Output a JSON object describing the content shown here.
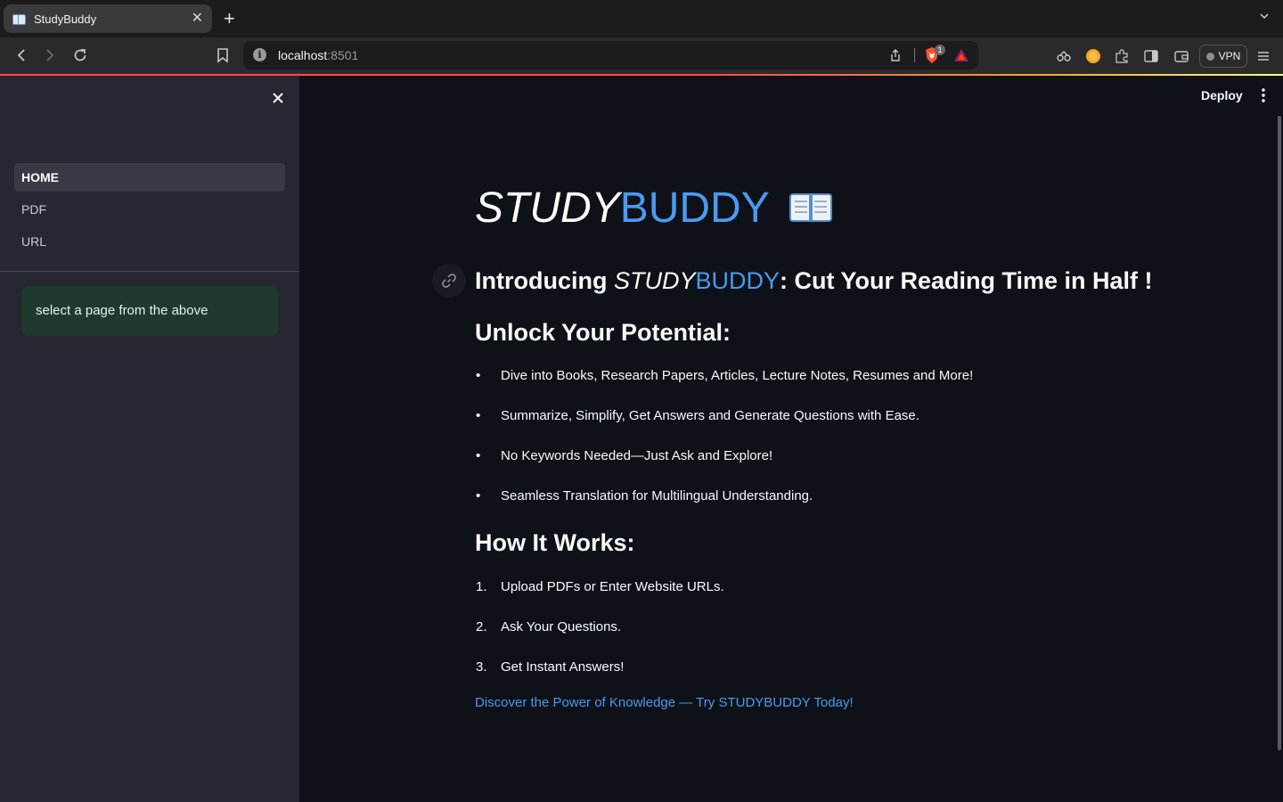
{
  "browser": {
    "tab_title": "StudyBuddy",
    "url_host": "localhost",
    "url_port": ":8501",
    "shields_count": "1",
    "vpn_label": "VPN"
  },
  "app": {
    "deploy_label": "Deploy",
    "sidebar": {
      "items": [
        {
          "label": "HOME",
          "active": true
        },
        {
          "label": "PDF",
          "active": false
        },
        {
          "label": "URL",
          "active": false
        }
      ],
      "info_message": "select a page from the above"
    },
    "main": {
      "logo_part1": "STUDY",
      "logo_part2": "BUDDY",
      "intro": {
        "prefix": "Introducing ",
        "brand1": "STUDY",
        "brand2": "BUDDY",
        "suffix": ": Cut Your Reading Time in Half !"
      },
      "section1_title": "Unlock Your Potential:",
      "section1_items": [
        "Dive into Books, Research Papers, Articles, Lecture Notes, Resumes and More!",
        "Summarize, Simplify, Get Answers and Generate Questions with Ease.",
        "No Keywords Needed—Just Ask and Explore!",
        "Seamless Translation for Multilingual Understanding."
      ],
      "section2_title": "How It Works:",
      "section2_items": [
        {
          "num": "1.",
          "text": "Upload PDFs or Enter Website URLs."
        },
        {
          "num": "2.",
          "text": "Ask Your Questions."
        },
        {
          "num": "3.",
          "text": "Get Instant Answers!"
        }
      ],
      "cta": "Discover the Power of Knowledge — Try STUDYBUDDY Today!"
    }
  },
  "colors": {
    "accent_blue": "#4a9af0",
    "sidebar_bg": "#262730",
    "main_bg": "#0e1117",
    "info_bg": "#1f3a2d"
  },
  "icons": [
    "book-icon",
    "close-icon",
    "link-icon",
    "more-vertical-icon",
    "back-icon",
    "forward-icon",
    "reload-icon",
    "bookmark-icon",
    "share-icon",
    "brave-shields-icon",
    "bat-rewards-icon",
    "extensions-icon",
    "sidebar-icon",
    "wallet-icon",
    "menu-icon"
  ]
}
